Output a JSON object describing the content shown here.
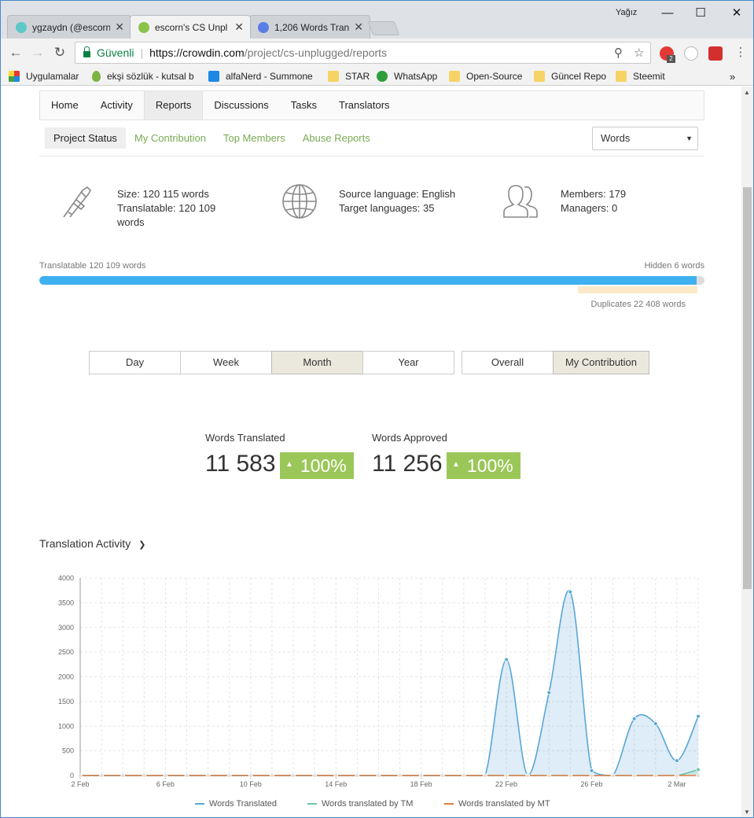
{
  "browser": {
    "user_name": "Yağız",
    "tabs": [
      {
        "title": "ygzaydn (@escorn",
        "fav_color": "#5ec8c8",
        "active": false
      },
      {
        "title": "escorn's CS Unpl",
        "fav_color": "#8bc34a",
        "active": true
      },
      {
        "title": "1,206 Words Trans",
        "fav_color": "#5b7ee5",
        "active": false
      }
    ],
    "secure_label": "Güvenli",
    "url_host": "https://crowdin.com",
    "url_path": "/project/cs-unplugged/reports",
    "bookmarks": [
      {
        "label": "Uygulamalar",
        "icon": "apps-grid-icon"
      },
      {
        "label": "ekşi sözlük - kutsal b",
        "icon": "drop-icon"
      },
      {
        "label": "alfaNerd - Summone",
        "icon": "site-icon"
      },
      {
        "label": "STAR",
        "icon": "folder-icon"
      },
      {
        "label": "WhatsApp",
        "icon": "whatsapp-icon"
      },
      {
        "label": "Open-Source",
        "icon": "folder-icon"
      },
      {
        "label": "Güncel Repo",
        "icon": "folder-icon"
      },
      {
        "label": "Steemit",
        "icon": "folder-icon"
      }
    ],
    "extension_badge": "2"
  },
  "nav": {
    "items": [
      "Home",
      "Activity",
      "Reports",
      "Discussions",
      "Tasks",
      "Translators"
    ],
    "active": "Reports"
  },
  "subnav": {
    "items": [
      "Project Status",
      "My Contribution",
      "Top Members",
      "Abuse Reports"
    ],
    "active": "Project Status"
  },
  "unit_select": {
    "value": "Words"
  },
  "stats": {
    "size": "Size: 120 115 words",
    "translatable_1": "Translatable: 120 109",
    "translatable_2": "words",
    "source_lang": "Source language: English",
    "target_langs": "Target languages: 35",
    "members": "Members: 179",
    "managers": "Managers: 0"
  },
  "progress": {
    "translatable_label": "Translatable 120 109 words",
    "hidden_label": "Hidden 6 words",
    "duplicates_label": "Duplicates 22 408 words",
    "translatable_fraction": 0.99995
  },
  "period_buttons": {
    "items": [
      "Day",
      "Week",
      "Month",
      "Year"
    ],
    "active": "Month"
  },
  "scope_buttons": {
    "items": [
      "Overall",
      "My Contribution"
    ],
    "active": "My Contribution"
  },
  "metrics": {
    "translated_label": "Words Translated",
    "translated_value": "11 583",
    "translated_change": "100%",
    "approved_label": "Words Approved",
    "approved_value": "11 256",
    "approved_change": "100%"
  },
  "activity_title": "Translation Activity",
  "chart_data": {
    "type": "area",
    "title": "Translation Activity",
    "x_tick_labels": [
      "2 Feb",
      "6 Feb",
      "10 Feb",
      "14 Feb",
      "18 Feb",
      "22 Feb",
      "26 Feb",
      "2 Mar"
    ],
    "x": [
      "2 Feb",
      "3 Feb",
      "4 Feb",
      "5 Feb",
      "6 Feb",
      "7 Feb",
      "8 Feb",
      "9 Feb",
      "10 Feb",
      "11 Feb",
      "12 Feb",
      "13 Feb",
      "14 Feb",
      "15 Feb",
      "16 Feb",
      "17 Feb",
      "18 Feb",
      "19 Feb",
      "20 Feb",
      "21 Feb",
      "22 Feb",
      "23 Feb",
      "24 Feb",
      "25 Feb",
      "26 Feb",
      "27 Feb",
      "28 Feb",
      "1 Mar",
      "2 Mar",
      "3 Mar"
    ],
    "ylim": [
      0,
      4000
    ],
    "y_ticks": [
      0,
      500,
      1000,
      1500,
      2000,
      2500,
      3000,
      3500,
      4000
    ],
    "grid": true,
    "legend_position": "bottom",
    "series": [
      {
        "name": "Words Translated",
        "color": "#5aa6d6",
        "values": [
          0,
          0,
          0,
          0,
          0,
          0,
          0,
          0,
          0,
          0,
          0,
          0,
          0,
          0,
          0,
          0,
          0,
          0,
          0,
          0,
          2350,
          0,
          1680,
          3720,
          100,
          0,
          1150,
          1050,
          300,
          1200
        ]
      },
      {
        "name": "Words translated by TM",
        "color": "#6cc3a6",
        "values": [
          0,
          0,
          0,
          0,
          0,
          0,
          0,
          0,
          0,
          0,
          0,
          0,
          0,
          0,
          0,
          0,
          0,
          0,
          0,
          0,
          0,
          0,
          0,
          0,
          0,
          0,
          0,
          0,
          0,
          120
        ]
      },
      {
        "name": "Words translated by MT",
        "color": "#e07b42",
        "values": [
          0,
          0,
          0,
          0,
          0,
          0,
          0,
          0,
          0,
          0,
          0,
          0,
          0,
          0,
          0,
          0,
          0,
          0,
          0,
          0,
          0,
          0,
          0,
          0,
          0,
          0,
          0,
          0,
          0,
          0
        ]
      }
    ]
  }
}
